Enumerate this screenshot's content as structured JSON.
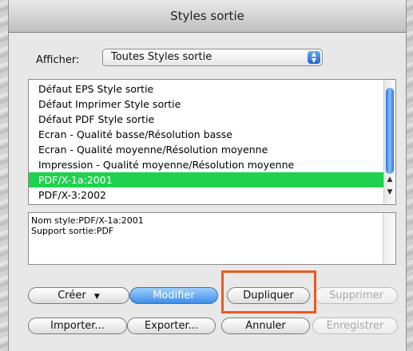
{
  "window": {
    "title": "Styles sortie"
  },
  "filter": {
    "label": "Afficher:",
    "selected": "Toutes Styles sortie"
  },
  "styles_list": {
    "items": [
      "Défaut EPS Style sortie",
      "Défaut Imprimer Style sortie",
      "Défaut PDF Style sortie",
      "Ecran - Qualité basse/Résolution basse",
      "Ecran - Qualité moyenne/Résolution moyenne",
      "Impression - Qualité moyenne/Résolution moyenne",
      "PDF/X-1a:2001",
      "PDF/X-3:2002"
    ],
    "selected_index": 6
  },
  "info": {
    "line1": "Nom style:PDF/X-1a:2001",
    "line2": "Support sortie:PDF"
  },
  "buttons": {
    "creer": "Créer",
    "modifier": "Modifier",
    "dupliquer": "Dupliquer",
    "supprimer": "Supprimer",
    "importer": "Importer...",
    "exporter": "Exporter...",
    "annuler": "Annuler",
    "enregistrer": "Enregistrer"
  },
  "colors": {
    "selection": "#1fd24d",
    "primary_button": "#3f8ee8",
    "annotation_highlight": "#e85b1e"
  }
}
